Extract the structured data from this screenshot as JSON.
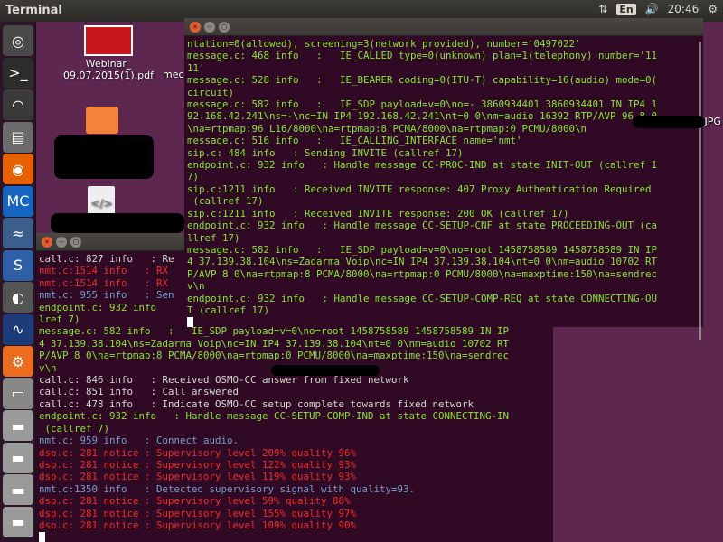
{
  "topbar": {
    "title": "Terminal",
    "lang": "En",
    "time": "20:46"
  },
  "launcher": {
    "items": [
      {
        "name": "ubuntu-icon",
        "glyph": "◎",
        "bg": "#4a4a4a"
      },
      {
        "name": "terminal-icon",
        "glyph": ">_",
        "bg": "#2c2c2c"
      },
      {
        "name": "wifi-icon",
        "glyph": "◠",
        "bg": "#3a3a3a"
      },
      {
        "name": "files-icon",
        "glyph": "▤",
        "bg": "#6b6b6b"
      },
      {
        "name": "firefox-icon",
        "glyph": "◉",
        "bg": "#e66000"
      },
      {
        "name": "app-mc-icon",
        "glyph": "MC",
        "bg": "#1565c0"
      },
      {
        "name": "wave-app-icon",
        "glyph": "≈",
        "bg": "#3b5f8a"
      },
      {
        "name": "s-app-icon",
        "glyph": "S",
        "bg": "#2f5fa7"
      },
      {
        "name": "user-photo-icon",
        "glyph": "◐",
        "bg": "#555"
      },
      {
        "name": "scope-icon",
        "glyph": "∿",
        "bg": "#1f3c7a"
      },
      {
        "name": "settings-gear-icon",
        "glyph": "⚙",
        "bg": "#ea6d1f"
      },
      {
        "name": "window-icon",
        "glyph": "▭",
        "bg": "#888"
      },
      {
        "name": "drive-icon",
        "glyph": "▬",
        "bg": "#9a9a9a"
      },
      {
        "name": "drive-icon",
        "glyph": "▬",
        "bg": "#9a9a9a"
      },
      {
        "name": "drive-icon",
        "glyph": "▬",
        "bg": "#9a9a9a"
      },
      {
        "name": "trash-icon",
        "glyph": "▬",
        "bg": "#9a9a9a"
      }
    ]
  },
  "desktop": {
    "pdf_label_1": "Webinar_",
    "pdf_label_2": "09.07.2015(1).pdf",
    "mec_label": "mec",
    "jpg_label": ".JPG"
  },
  "front_terminal": {
    "lines": [
      {
        "c": "g",
        "t": "ntation=0(allowed), screening=3(network provided), number='0497022'"
      },
      {
        "c": "g",
        "t": "message.c: 468 info   :   IE_CALLED type=0(unknown) plan=1(telephony) number='11"
      },
      {
        "c": "g",
        "t": "11'"
      },
      {
        "c": "g",
        "t": "message.c: 528 info   :   IE_BEARER coding=0(ITU-T) capability=16(audio) mode=0("
      },
      {
        "c": "g",
        "t": "circuit)"
      },
      {
        "c": "g",
        "t": "message.c: 582 info   :   IE_SDP payload=v=0\\no=- 3860934401 3860934401 IN IP4 1"
      },
      {
        "c": "g",
        "t": "92.168.42.241\\ns=-\\nc=IN IP4 192.168.42.241\\nt=0 0\\nm=audio 16392 RTP/AVP 96 8 0"
      },
      {
        "c": "g",
        "t": "\\na=rtpmap:96 L16/8000\\na=rtpmap:8 PCMA/8000\\na=rtpmap:0 PCMU/8000\\n"
      },
      {
        "c": "g",
        "t": "message.c: 516 info   :   IE_CALLING_INTERFACE name='nmt'"
      },
      {
        "c": "g",
        "t": "sip.c: 484 info   : Sending INVITE (callref 17)"
      },
      {
        "c": "g",
        "t": "endpoint.c: 932 info   : Handle message CC-PROC-IND at state INIT-OUT (callref 1"
      },
      {
        "c": "g",
        "t": "7)"
      },
      {
        "c": "g",
        "t": "sip.c:1211 info   : Received INVITE response: 407 Proxy Authentication Required"
      },
      {
        "c": "g",
        "t": " (callref 17)"
      },
      {
        "c": "g",
        "t": "sip.c:1211 info   : Received INVITE response: 200 OK (callref 17)"
      },
      {
        "c": "g",
        "t": "endpoint.c: 932 info   : Handle message CC-SETUP-CNF at state PROCEEDING-OUT (ca"
      },
      {
        "c": "g",
        "t": "llref 17)"
      },
      {
        "c": "g",
        "t": "message.c: 582 info   :   IE_SDP payload=v=0\\no=root 1458758589 1458758589 IN IP"
      },
      {
        "c": "g",
        "t": "4 37.139.38.104\\ns=Zadarma Voip\\nc=IN IP4 37.139.38.104\\nt=0 0\\nm=audio 10702 RT"
      },
      {
        "c": "g",
        "t": "P/AVP 8 0\\na=rtpmap:8 PCMA/8000\\na=rtpmap:0 PCMU/8000\\na=maxptime:150\\na=sendrec"
      },
      {
        "c": "g",
        "t": "v\\n"
      },
      {
        "c": "g",
        "t": "endpoint.c: 932 info   : Handle message CC-SETUP-COMP-REQ at state CONNECTING-OU"
      },
      {
        "c": "g",
        "t": "T (callref 17)"
      }
    ]
  },
  "back_terminal": {
    "lines": [
      {
        "c": "w",
        "t": "call.c: 827 info   : Re"
      },
      {
        "c": "r",
        "t": "nmt.c:1514 info   : RX"
      },
      {
        "c": "r",
        "t": "nmt.c:1514 info   : RX"
      },
      {
        "c": "b",
        "t": "nmt.c: 955 info   : Sen"
      },
      {
        "c": "g",
        "t": "endpoint.c: 932 info   "
      },
      {
        "c": "g",
        "t": "lref 7)"
      },
      {
        "c": "g",
        "t": "message.c: 582 info   :   IE_SDP payload=v=0\\no=root 1458758589 1458758589 IN IP"
      },
      {
        "c": "g",
        "t": "4 37.139.38.104\\ns=Zadarma Voip\\nc=IN IP4 37.139.38.104\\nt=0 0\\nm=audio 10702 RT"
      },
      {
        "c": "g",
        "t": "P/AVP 8 0\\na=rtpmap:8 PCMA/8000\\na=rtpmap:0 PCMU/8000\\na=maxptime:150\\na=sendrec"
      },
      {
        "c": "g",
        "t": "v\\n"
      },
      {
        "c": "w",
        "t": "call.c: 846 info   : Received OSMO-CC answer from fixed network"
      },
      {
        "c": "w",
        "t": "call.c: 851 info   : Call answered"
      },
      {
        "c": "w",
        "t": "call.c: 478 info   : Indicate OSMO-CC setup complete towards fixed network"
      },
      {
        "c": "g",
        "t": "endpoint.c: 932 info   : Handle message CC-SETUP-COMP-IND at state CONNECTING-IN"
      },
      {
        "c": "g",
        "t": " (callref 7)"
      },
      {
        "c": "b",
        "t": "nmt.c: 959 info   : Connect audio."
      },
      {
        "c": "r",
        "t": "dsp.c: 281 notice : Supervisory level 209% quality 96%"
      },
      {
        "c": "r",
        "t": "dsp.c: 281 notice : Supervisory level 122% quality 93%"
      },
      {
        "c": "r",
        "t": "dsp.c: 281 notice : Supervisory level 119% quality 93%"
      },
      {
        "c": "b",
        "t": "nmt.c:1350 info   : Detected supervisory signal with quality=93."
      },
      {
        "c": "r",
        "t": "dsp.c: 281 notice : Supervisory level 59% quality 88%"
      },
      {
        "c": "r",
        "t": "dsp.c: 281 notice : Supervisory level 155% quality 97%"
      },
      {
        "c": "r",
        "t": "dsp.c: 281 notice : Supervisory level 109% quality 90%"
      }
    ]
  }
}
